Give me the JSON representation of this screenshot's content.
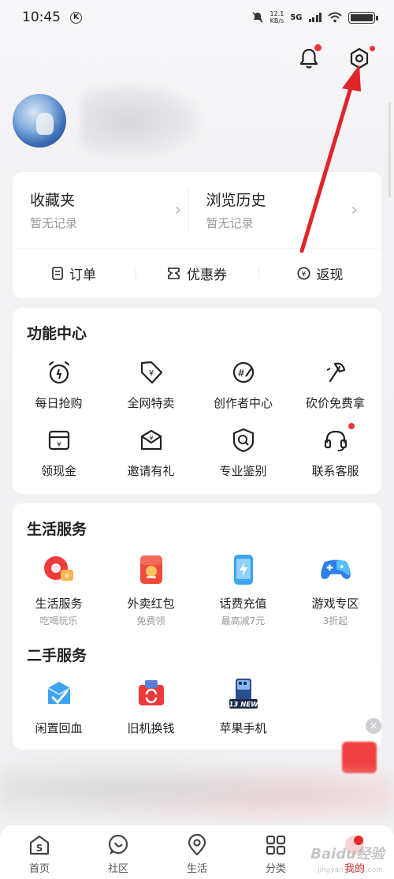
{
  "status": {
    "time": "10:45",
    "carrier_badge": "K",
    "net_speed_value": "12.1",
    "net_speed_unit": "KB/s",
    "network": "5G"
  },
  "header": {
    "bell_icon": "bell-icon",
    "settings_icon": "settings-hex-icon"
  },
  "profile": {
    "avatar_icon": "avatar"
  },
  "favorites": {
    "collect_title": "收藏夹",
    "collect_sub": "暂无记录",
    "history_title": "浏览历史",
    "history_sub": "暂无记录"
  },
  "quick": [
    {
      "label": "订单",
      "icon": "order-icon"
    },
    {
      "label": "优惠券",
      "icon": "coupon-icon"
    },
    {
      "label": "返现",
      "icon": "cashback-icon"
    }
  ],
  "func_center": {
    "title": "功能中心",
    "row1": [
      {
        "label": "每日抢购",
        "icon": "alarm-clock-icon"
      },
      {
        "label": "全网特卖",
        "icon": "price-tag-icon"
      },
      {
        "label": "创作者中心",
        "icon": "creator-icon"
      },
      {
        "label": "砍价免费拿",
        "icon": "axe-icon"
      }
    ],
    "row2": [
      {
        "label": "领现金",
        "icon": "cash-box-icon"
      },
      {
        "label": "邀请有礼",
        "icon": "gift-envelope-icon"
      },
      {
        "label": "专业鉴别",
        "icon": "search-shield-icon"
      },
      {
        "label": "联系客服",
        "icon": "headset-icon"
      }
    ]
  },
  "life_services": {
    "title": "生活服务",
    "items": [
      {
        "label": "生活服务",
        "sub": "吃喝玩乐",
        "icon": "life-service-icon"
      },
      {
        "label": "外卖红包",
        "sub": "免费领",
        "icon": "takeout-redpacket-icon"
      },
      {
        "label": "话费充值",
        "sub": "最高减7元",
        "icon": "phone-recharge-icon"
      },
      {
        "label": "游戏专区",
        "sub": "3折起",
        "icon": "gamepad-icon"
      }
    ]
  },
  "second_hand": {
    "title": "二手服务",
    "items": [
      {
        "label": "闲置回血",
        "icon": "idle-recycle-icon"
      },
      {
        "label": "旧机换钱",
        "icon": "trade-in-icon"
      },
      {
        "label": "苹果手机",
        "icon": "iphone-icon",
        "badge": "13 NEW"
      }
    ]
  },
  "nav": [
    {
      "label": "首页",
      "icon": "home-s-icon"
    },
    {
      "label": "社区",
      "icon": "community-icon"
    },
    {
      "label": "生活",
      "icon": "location-pin-icon"
    },
    {
      "label": "分类",
      "icon": "category-grid-icon"
    },
    {
      "label": "我的",
      "icon": "profile-tab-icon"
    }
  ],
  "watermark": {
    "text": "Baidu经验",
    "sub": "jingyan.baidu.com"
  },
  "colors": {
    "accent": "#e62b2b",
    "arrow": "#e0262a"
  }
}
